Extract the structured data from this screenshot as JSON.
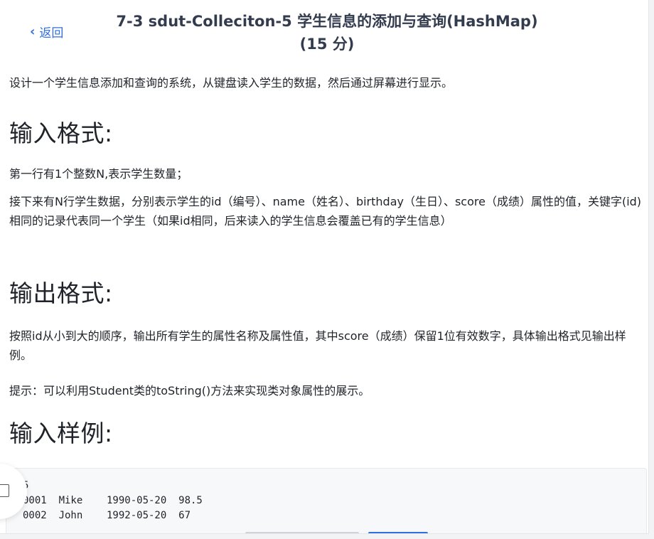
{
  "nav": {
    "back_label": "返回"
  },
  "problem": {
    "title_line1": "7-3 sdut-Colleciton-5 学生信息的添加与查询(HashMap)",
    "title_line2": "(15 分)"
  },
  "content": {
    "intro": "设计一个学生信息添加和查询的系统，从键盘读入学生的数据，然后通过屏幕进行显示。",
    "input_heading": "输入格式:",
    "input_line1": "第一行有1个整数N,表示学生数量；",
    "input_line2": "接下来有N行学生数据，分别表示学生的id（编号）、name（姓名）、birthday（生日）、score（成绩）属性的值，关键字(id)相同的记录代表同一个学生（如果id相同，后来读入的学生信息会覆盖已有的学生信息）",
    "output_heading": "输出格式:",
    "output_line1": "按照id从小到大的顺序，输出所有学生的属性名称及属性值，其中score（成绩）保留1位有效数字，具体输出格式见输出样例。",
    "output_hint": "提示：可以利用Student类的toString()方法来实现类对象属性的展示。",
    "sample_heading": "输入样例:",
    "sample_code": "5\n0001  Mike    1990-05-20  98.5\n0002  John    1992-05-20  67"
  },
  "colors": {
    "link": "#2f6fde",
    "title": "#333c4e",
    "text": "#1f2329",
    "code_bg": "#f7f8fa"
  }
}
